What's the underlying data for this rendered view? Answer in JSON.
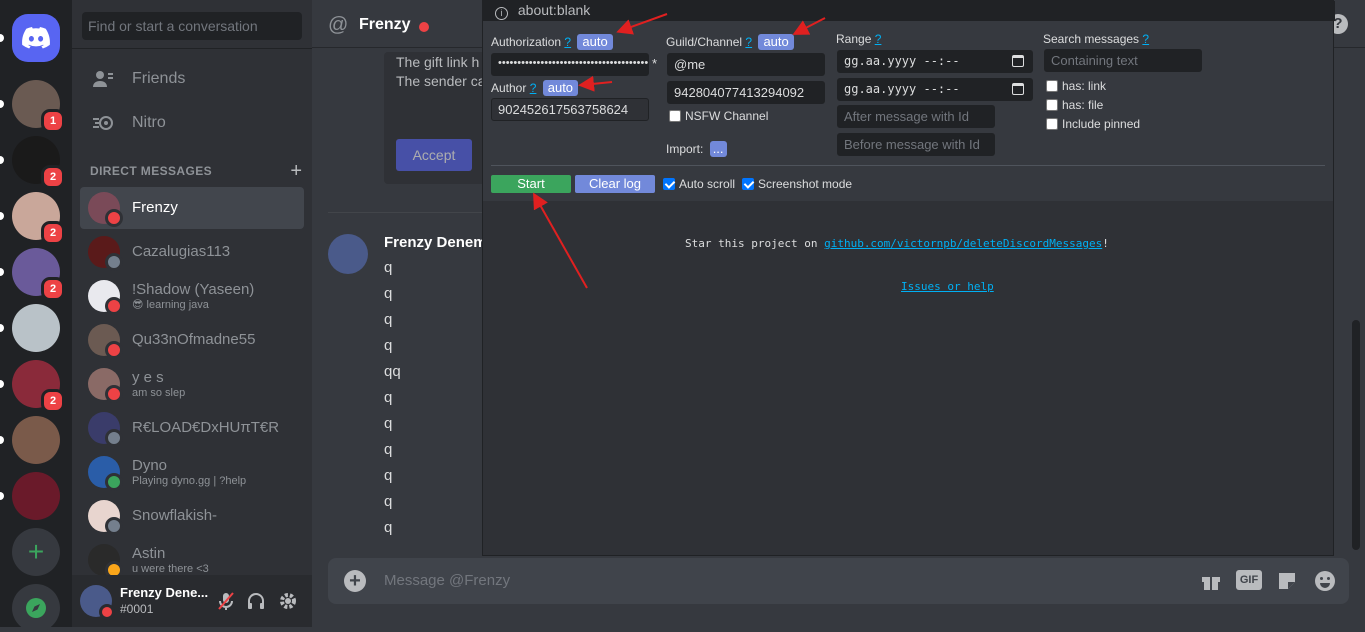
{
  "servers": [
    {
      "badge": ""
    },
    {
      "badge": "1"
    },
    {
      "badge": "2"
    },
    {
      "badge": "2"
    },
    {
      "badge": "2"
    },
    {
      "badge": ""
    },
    {
      "badge": "2"
    },
    {
      "badge": ""
    },
    {
      "badge": ""
    }
  ],
  "dm": {
    "search_placeholder": "Find or start a conversation",
    "friends_label": "Friends",
    "nitro_label": "Nitro",
    "header": "DIRECT MESSAGES",
    "items": [
      {
        "name": "Frenzy",
        "sub": "",
        "status": "dnd",
        "color": "#7a4a58"
      },
      {
        "name": "Cazalugias113",
        "sub": "",
        "status": "offline",
        "color": "#5a1a1a"
      },
      {
        "name": "!Shadow (Yaseen)",
        "sub": "😎 learning java",
        "status": "dnd",
        "color": "#e9e9ee"
      },
      {
        "name": "Qu33nOfmadne55",
        "sub": "",
        "status": "dnd",
        "color": "#6b5a52"
      },
      {
        "name": "y e s",
        "sub": "am so slep",
        "status": "dnd",
        "color": "#8a6a66"
      },
      {
        "name": "R€LOAD€DxHUπT€R",
        "sub": "",
        "status": "offline",
        "color": "#3a3c6a"
      },
      {
        "name": "Dyno",
        "sub": "Playing dyno.gg | ?help",
        "status": "online",
        "color": "#2a5da8"
      },
      {
        "name": "Snowflakish-",
        "sub": "",
        "status": "offline",
        "color": "#e8d5cf"
      },
      {
        "name": "Astin",
        "sub": "u were there <3",
        "status": "idle",
        "color": "#2a2a2a"
      }
    ]
  },
  "user": {
    "name": "Frenzy Dene...",
    "tag": "#0001"
  },
  "main": {
    "channel": "Frenzy",
    "gift_line1": "The gift link h",
    "gift_line2": "The sender ca",
    "accept_label": "Accept",
    "author": "Frenzy Denem",
    "messages": [
      "q",
      "q",
      "q",
      "q",
      "qq",
      "q",
      "q",
      "q",
      "q",
      "q",
      "q"
    ],
    "input_placeholder": "Message @Frenzy",
    "gif_label": "GIF"
  },
  "popup": {
    "address": "about:blank",
    "auth_label": "Authorization",
    "help": "?",
    "auto": "auto",
    "auth_value": "••••••••••••••••••••••••••••••••••••••••",
    "required": "*",
    "author_label": "Author",
    "author_value": "902452617563758624",
    "guild_label": "Guild/Channel",
    "guild_value": "@me",
    "channel_value": "942804077413294092",
    "nsfw_label": "NSFW Channel",
    "import_label": "Import:",
    "import_btn": "...",
    "range_label": "Range",
    "range_from": "gg.aa.yyyy --:--",
    "range_to": "gg.aa.yyyy --:--",
    "after_placeholder": "After message with Id",
    "before_placeholder": "Before message with Id",
    "search_label": "Search messages",
    "search_placeholder": "Containing text",
    "has_link": "has: link",
    "has_file": "has: file",
    "include_pinned": "Include pinned",
    "start": "Start",
    "clear_log": "Clear log",
    "auto_scroll": "Auto scroll",
    "screenshot_mode": "Screenshot mode",
    "star_text": "Star this project on",
    "star_link": "github.com/victornpb/deleteDiscordMessages",
    "star_end": "!",
    "issues": "Issues or help"
  }
}
